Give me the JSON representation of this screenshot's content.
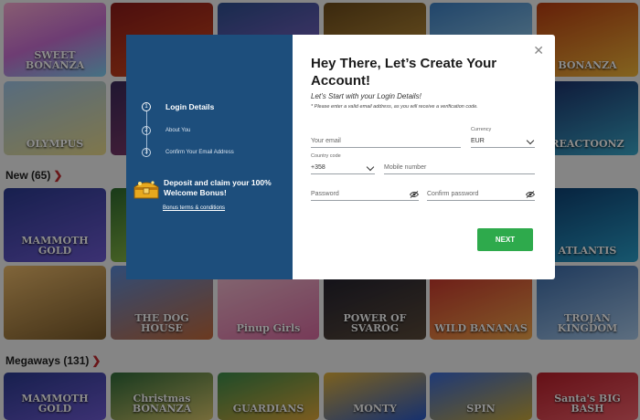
{
  "background": {
    "sections": [
      {
        "title": "New (65)"
      },
      {
        "title": "Megaways (131)"
      }
    ],
    "tiles": {
      "sweet_bonanza": "SWEET BONANZA",
      "bonanza": "BONANZA",
      "olympus": "OLYMPUS",
      "reactoonz": "REACTOONZ",
      "mammoth": "MAMMOTH GOLD",
      "atlantis": "ATLANTIS",
      "dog_house": "THE DOG HOUSE",
      "pinup": "Pinup Girls",
      "svarog": "POWER OF SVAROG",
      "wild_bananas": "WILD BANANAS",
      "trojan": "TROJAN KINGDOM",
      "mammoth2": "MAMMOTH GOLD",
      "christmas": "Christmas BONANZA",
      "guardians": "GUARDIANS",
      "monty": "MONTY",
      "spin": "SPIN",
      "santa": "Santa's BIG BASH"
    }
  },
  "modal": {
    "steps": [
      {
        "num": "1",
        "label": "Login Details"
      },
      {
        "num": "2",
        "label": "About You"
      },
      {
        "num": "3",
        "label": "Confirm Your Email Address"
      }
    ],
    "bonus_text": "Deposit and claim your 100% Welcome Bonus!",
    "bonus_link": "Bonus terms & conditions",
    "title": "Hey There, Let’s Create Your Account!",
    "subtitle": "Let’s Start with your Login Details!",
    "note": "* Please enter a valid email address, as you will receive a verification code.",
    "fields": {
      "email_placeholder": "Your email",
      "currency_label": "Currency",
      "currency_value": "EUR",
      "country_code_label": "Country code",
      "country_code_value": "+358",
      "mobile_placeholder": "Mobile number",
      "password_placeholder": "Password",
      "confirm_password_placeholder": "Confirm password"
    },
    "next_label": "NEXT",
    "close_icon": "close-icon"
  },
  "colors": {
    "sidebar_blue": "#1d4e7c",
    "next_green": "#2eaa4c"
  }
}
